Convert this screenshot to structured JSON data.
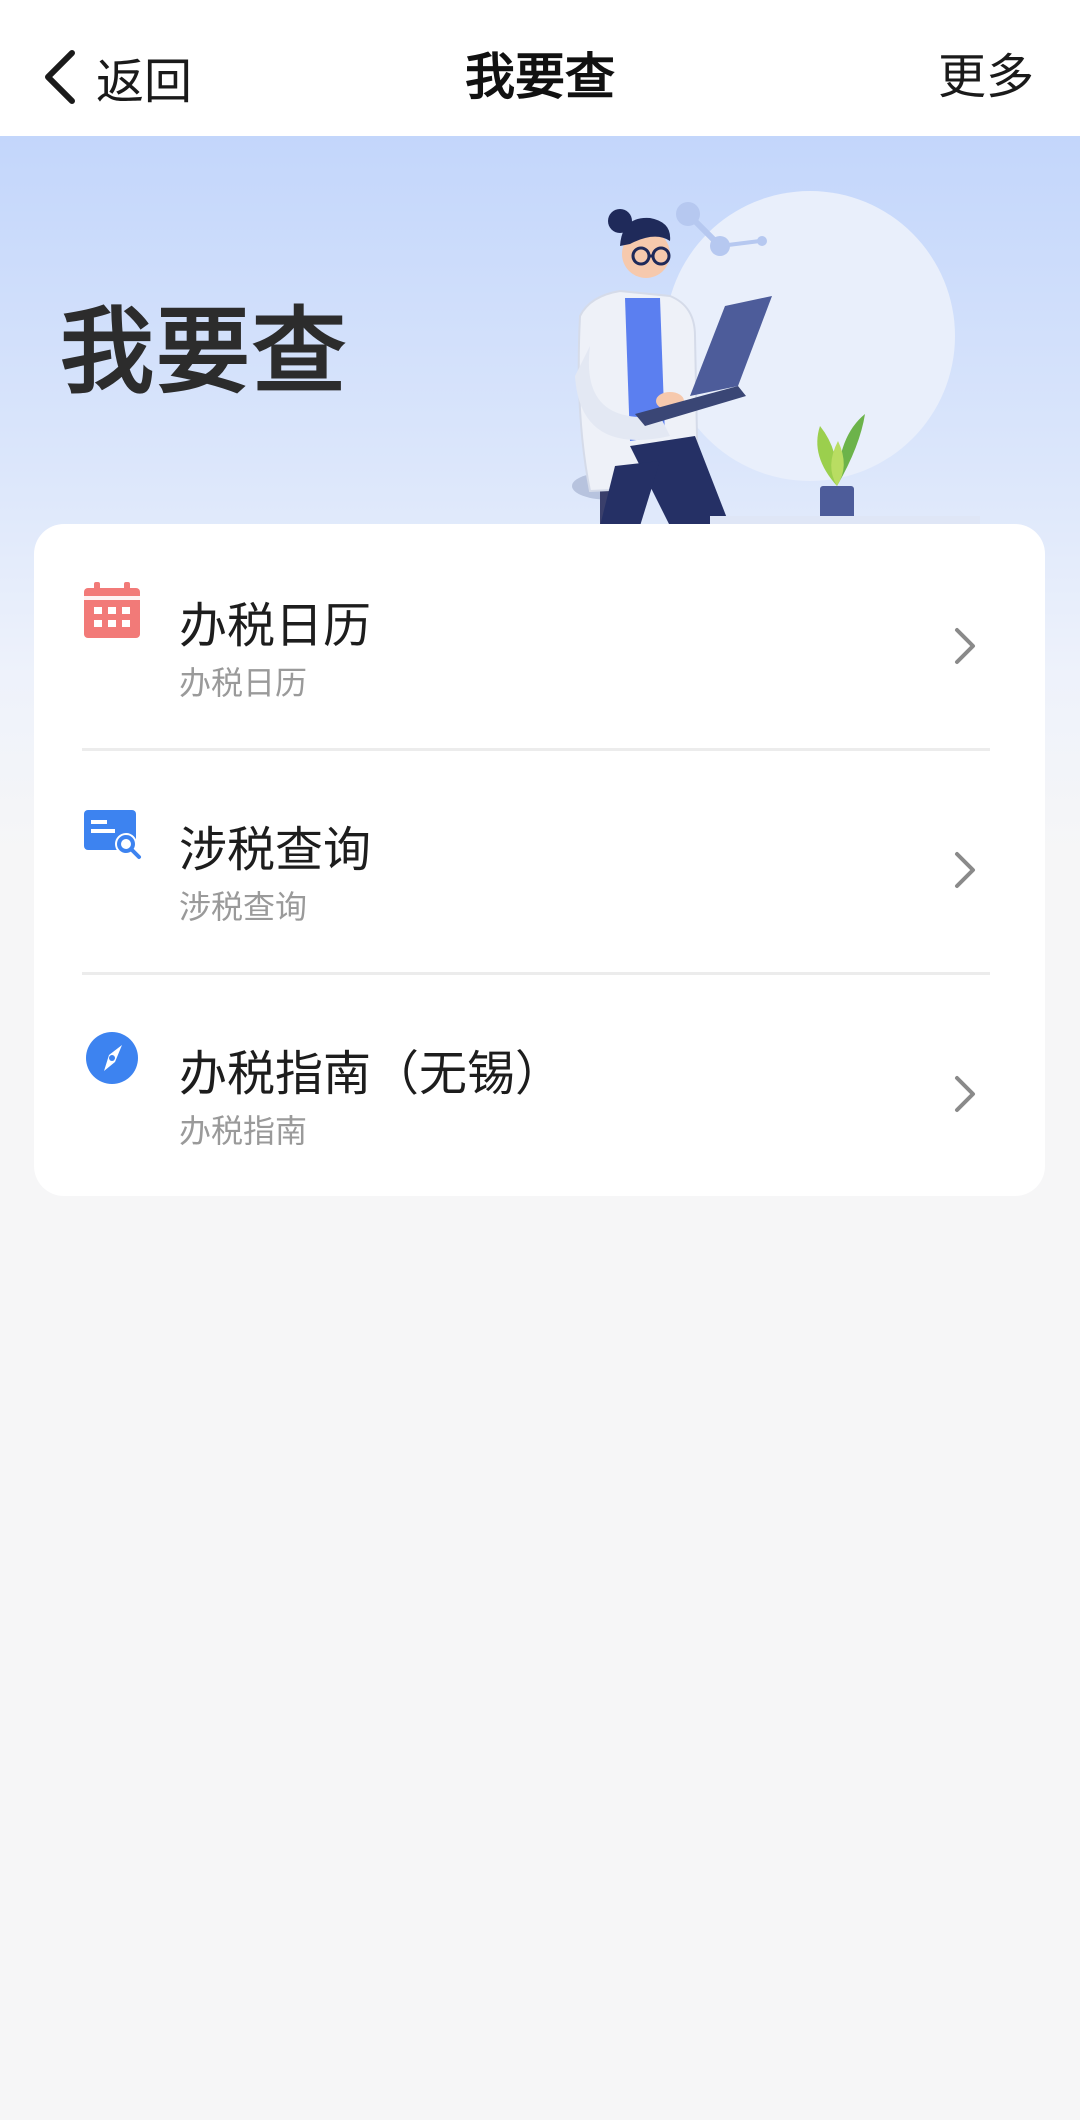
{
  "nav": {
    "back_label": "返回",
    "title": "我要查",
    "more_label": "更多"
  },
  "banner": {
    "title": "我要查"
  },
  "menu": {
    "items": [
      {
        "title": "办税日历",
        "subtitle": "办税日历",
        "icon": "calendar-icon",
        "icon_color": "#f27a78"
      },
      {
        "title": "涉税查询",
        "subtitle": "涉税查询",
        "icon": "search-card-icon",
        "icon_color": "#3d83f0"
      },
      {
        "title": "办税指南（无锡）",
        "subtitle": "办税指南",
        "icon": "compass-icon",
        "icon_color": "#3d83f0"
      }
    ]
  },
  "colors": {
    "banner_top": "#c3d6fb",
    "page_bg": "#f6f6f7",
    "accent_blue": "#3d83f0",
    "accent_red": "#f27a78"
  }
}
